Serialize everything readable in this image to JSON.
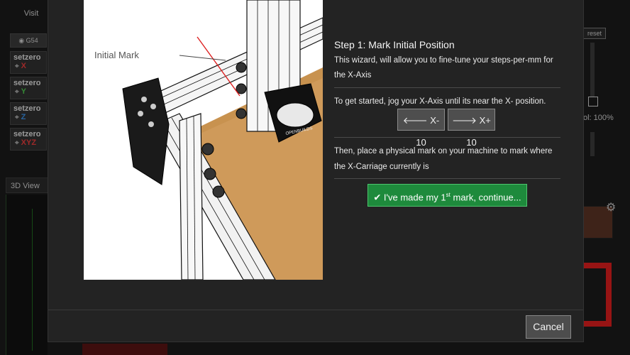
{
  "background": {
    "visit_tab": "Visit",
    "wcs_button": "G54",
    "setzero": [
      {
        "label": "setzero",
        "axis": "X",
        "color": "#e23b3b"
      },
      {
        "label": "setzero",
        "axis": "Y",
        "color": "#4cc24c"
      },
      {
        "label": "setzero",
        "axis": "Z",
        "color": "#3b8fe2"
      },
      {
        "label": "setzero",
        "axis": "XYZ",
        "color": "#e23b3b"
      }
    ],
    "view_tab": "3D View",
    "reset_button": "reset",
    "spindle_label": "ol: 100%"
  },
  "illustration": {
    "annotation": "Initial Mark",
    "router_brand": "OPENBUILDS"
  },
  "wizard": {
    "title": "Step 1: Mark Initial Position",
    "description": "This wizard, will allow you to fine-tune your steps-per-mm for the X-Axis",
    "jog_instruction": "To get started, jog your X-Axis until its near the X- position.",
    "jog_minus_label": "X- 10",
    "jog_plus_label": "X+ 10",
    "mark_instruction_line1": "Then, place a physical mark on your machine to mark where",
    "mark_instruction_line2": "the X-Carriage currently is",
    "continue_prefix": "I've made my 1",
    "continue_sup": "st",
    "continue_suffix": " mark, continue..."
  },
  "footer": {
    "cancel_label": "Cancel"
  },
  "colors": {
    "continue_bg": "#1e8a3c",
    "cancel_bg": "#4d4d4d",
    "modal_bg": "#232323"
  }
}
